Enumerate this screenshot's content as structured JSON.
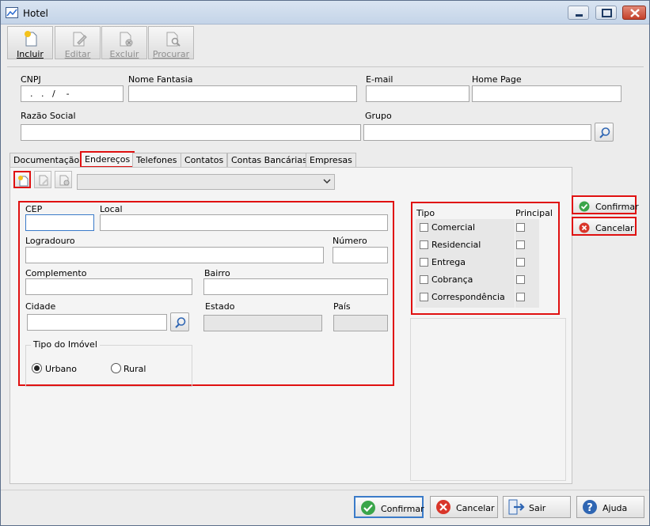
{
  "window": {
    "title": "Hotel",
    "icon": "chart-line-icon"
  },
  "toolbar": {
    "incluir": "Incluir",
    "editar": "Editar",
    "excluir": "Excluir",
    "procurar": "Procurar"
  },
  "header": {
    "cnpj_label": "CNPJ",
    "cnpj_value": "  .   .   /    -",
    "nome_fantasia_label": "Nome Fantasia",
    "email_label": "E-mail",
    "home_page_label": "Home Page",
    "razao_social_label": "Razão Social",
    "grupo_label": "Grupo"
  },
  "tabs": [
    "Documentação",
    "Endereços",
    "Telefones",
    "Contatos",
    "Contas Bancárias",
    "Empresas"
  ],
  "address": {
    "cep_label": "CEP",
    "local_label": "Local",
    "logradouro_label": "Logradouro",
    "numero_label": "Número",
    "complemento_label": "Complemento",
    "bairro_label": "Bairro",
    "cidade_label": "Cidade",
    "estado_label": "Estado",
    "pais_label": "País",
    "tipo_imovel_label": "Tipo do Imóvel",
    "urbano": "Urbano",
    "rural": "Rural"
  },
  "tipo": {
    "tipo_header": "Tipo",
    "principal_header": "Principal",
    "items": [
      "Comercial",
      "Residencial",
      "Entrega",
      "Cobrança",
      "Correspondência"
    ]
  },
  "side": {
    "confirmar": "Confirmar",
    "cancelar": "Cancelar"
  },
  "footer": {
    "confirmar": "Confirmar",
    "cancelar": "Cancelar",
    "sair": "Sair",
    "ajuda": "Ajuda"
  },
  "colors": {
    "highlight": "#e01010",
    "confirm": "#3aa54a",
    "cancel": "#d9362a",
    "help": "#2f66b3"
  }
}
